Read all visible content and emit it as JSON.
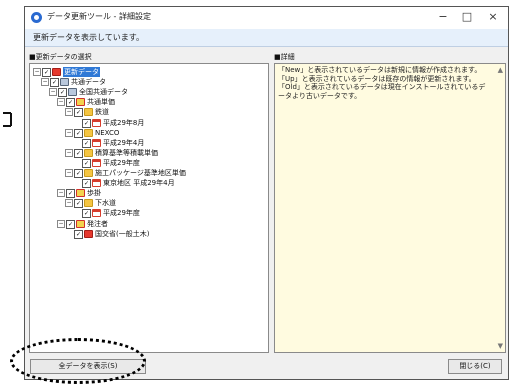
{
  "window": {
    "title": "データ更新ツール - 詳細設定",
    "controls": {
      "minimize": "−",
      "maximize": "□",
      "close": "×"
    }
  },
  "status": "更新データを表示しています。",
  "left_panel": {
    "header": "■更新データの選択"
  },
  "right_panel": {
    "header": "■詳細",
    "text": "「New」と表示されているデータは新規に情報が作成されます。\n「Up」と表示されているデータは既存の情報が更新されます。\n「Old」と表示されているデータは現在インストールされているデータより古いデータです。"
  },
  "tree": [
    {
      "label": "更新データ",
      "icon": "red-document-icon",
      "selected": true,
      "expander": "minus-icon"
    },
    {
      "label": "共通データ",
      "icon": "document-icon",
      "expander": "minus-icon"
    },
    {
      "label": "全国共通データ",
      "icon": "database-icon",
      "expander": "minus-icon"
    },
    {
      "label": "共通単価",
      "icon": "red-folder-icon",
      "expander": "minus-icon"
    },
    {
      "label": "鉄道",
      "icon": "folder-icon",
      "expander": "minus-icon"
    },
    {
      "label": "平成29年8月",
      "icon": "calendar-icon"
    },
    {
      "label": "NEXCO",
      "icon": "folder-icon",
      "expander": "minus-icon"
    },
    {
      "label": "平成29年4月",
      "icon": "calendar-icon"
    },
    {
      "label": "積算基準等積載単価",
      "icon": "folder-icon",
      "expander": "minus-icon"
    },
    {
      "label": "平成29年度",
      "icon": "calendar-icon"
    },
    {
      "label": "施工パッケージ基準地区単価",
      "icon": "folder-icon",
      "expander": "minus-icon"
    },
    {
      "label": "東京地区 平成29年4月",
      "icon": "calendar-icon"
    },
    {
      "label": "歩掛",
      "icon": "red-folder-icon",
      "expander": "minus-icon"
    },
    {
      "label": "下水道",
      "icon": "folder-icon",
      "expander": "minus-icon"
    },
    {
      "label": "平成29年度",
      "icon": "red-calendar-icon"
    },
    {
      "label": "発注者",
      "icon": "red-folder-icon",
      "expander": "minus-icon"
    },
    {
      "label": "国交省(一般土木)",
      "icon": "red-document-icon"
    }
  ],
  "buttons": {
    "show_all": "全データを表示(S)",
    "close": "閉じる(C)"
  },
  "colors": {
    "selection": "#3079d6",
    "detail_bg": "#fffbe0",
    "status_bg": "#e6f0fb"
  }
}
